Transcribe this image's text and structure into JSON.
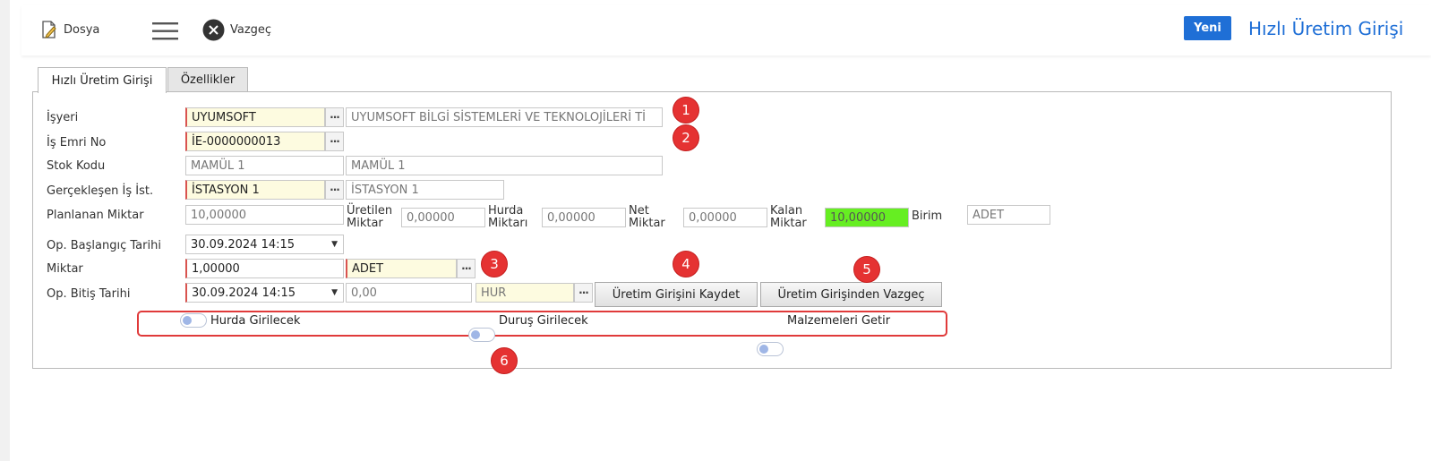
{
  "toolbar": {
    "file_label": "Dosya",
    "cancel_label": "Vazgeç",
    "new_label": "Yeni",
    "page_title": "Hızlı Üretim Girişi"
  },
  "tabs": [
    {
      "label": "Hızlı Üretim Girişi",
      "active": true
    },
    {
      "label": "Özellikler",
      "active": false
    }
  ],
  "form": {
    "workplace": {
      "label": "İşyeri",
      "code": "UYUMSOFT",
      "name": "UYUMSOFT BİLGİ SİSTEMLERİ VE TEKNOLOJİLERİ Tİ"
    },
    "work_order": {
      "label": "İş Emri No",
      "value": "İE-0000000013"
    },
    "stock_code": {
      "label": "Stok Kodu",
      "code": "MAMÜL 1",
      "name": "MAMÜL 1"
    },
    "workstation": {
      "label": "Gerçekleşen İş İst.",
      "code": "İSTASYON 1",
      "name": "İSTASYON 1"
    },
    "planned_qty": {
      "label": "Planlanan Miktar",
      "value": "10,00000"
    },
    "produced_qty": {
      "label_line1": "Üretilen",
      "label_line2": "Miktar",
      "value": "0,00000"
    },
    "scrap_qty": {
      "label_line1": "Hurda",
      "label_line2": "Miktarı",
      "value": "0,00000"
    },
    "net_qty": {
      "label_line1": "Net",
      "label_line2": "Miktar",
      "value": "0,00000"
    },
    "remaining_qty": {
      "label_line1": "Kalan",
      "label_line2": "Miktar",
      "value": "10,00000"
    },
    "unit": {
      "label": "Birim",
      "value": "ADET"
    },
    "start_date": {
      "label": "Op. Başlangıç Tarihi",
      "value": "30.09.2024 14:15"
    },
    "quantity": {
      "label": "Miktar",
      "value": "1,00000",
      "unit": "ADET"
    },
    "end_date": {
      "label": "Op. Bitiş Tarihi",
      "value": "30.09.2024 14:15",
      "duration": "0,00",
      "duration_unit": "HUR"
    }
  },
  "buttons": {
    "save": "Üretim Girişini Kaydet",
    "cancel_entry": "Üretim Girişinden Vazgeç"
  },
  "toggles": [
    {
      "label": "Hurda Girilecek",
      "on": false
    },
    {
      "label": "Duruş Girilecek",
      "on": false
    },
    {
      "label": "Malzemeleri Getir",
      "on": false
    }
  ],
  "markers": [
    "1",
    "2",
    "3",
    "4",
    "5",
    "6"
  ],
  "colors": {
    "accent": "#1f6fd6",
    "required_border": "#d9534f",
    "lookup_fill": "#fdfbe0",
    "remaining_fill": "#66ee22",
    "marker": "#e53232"
  }
}
